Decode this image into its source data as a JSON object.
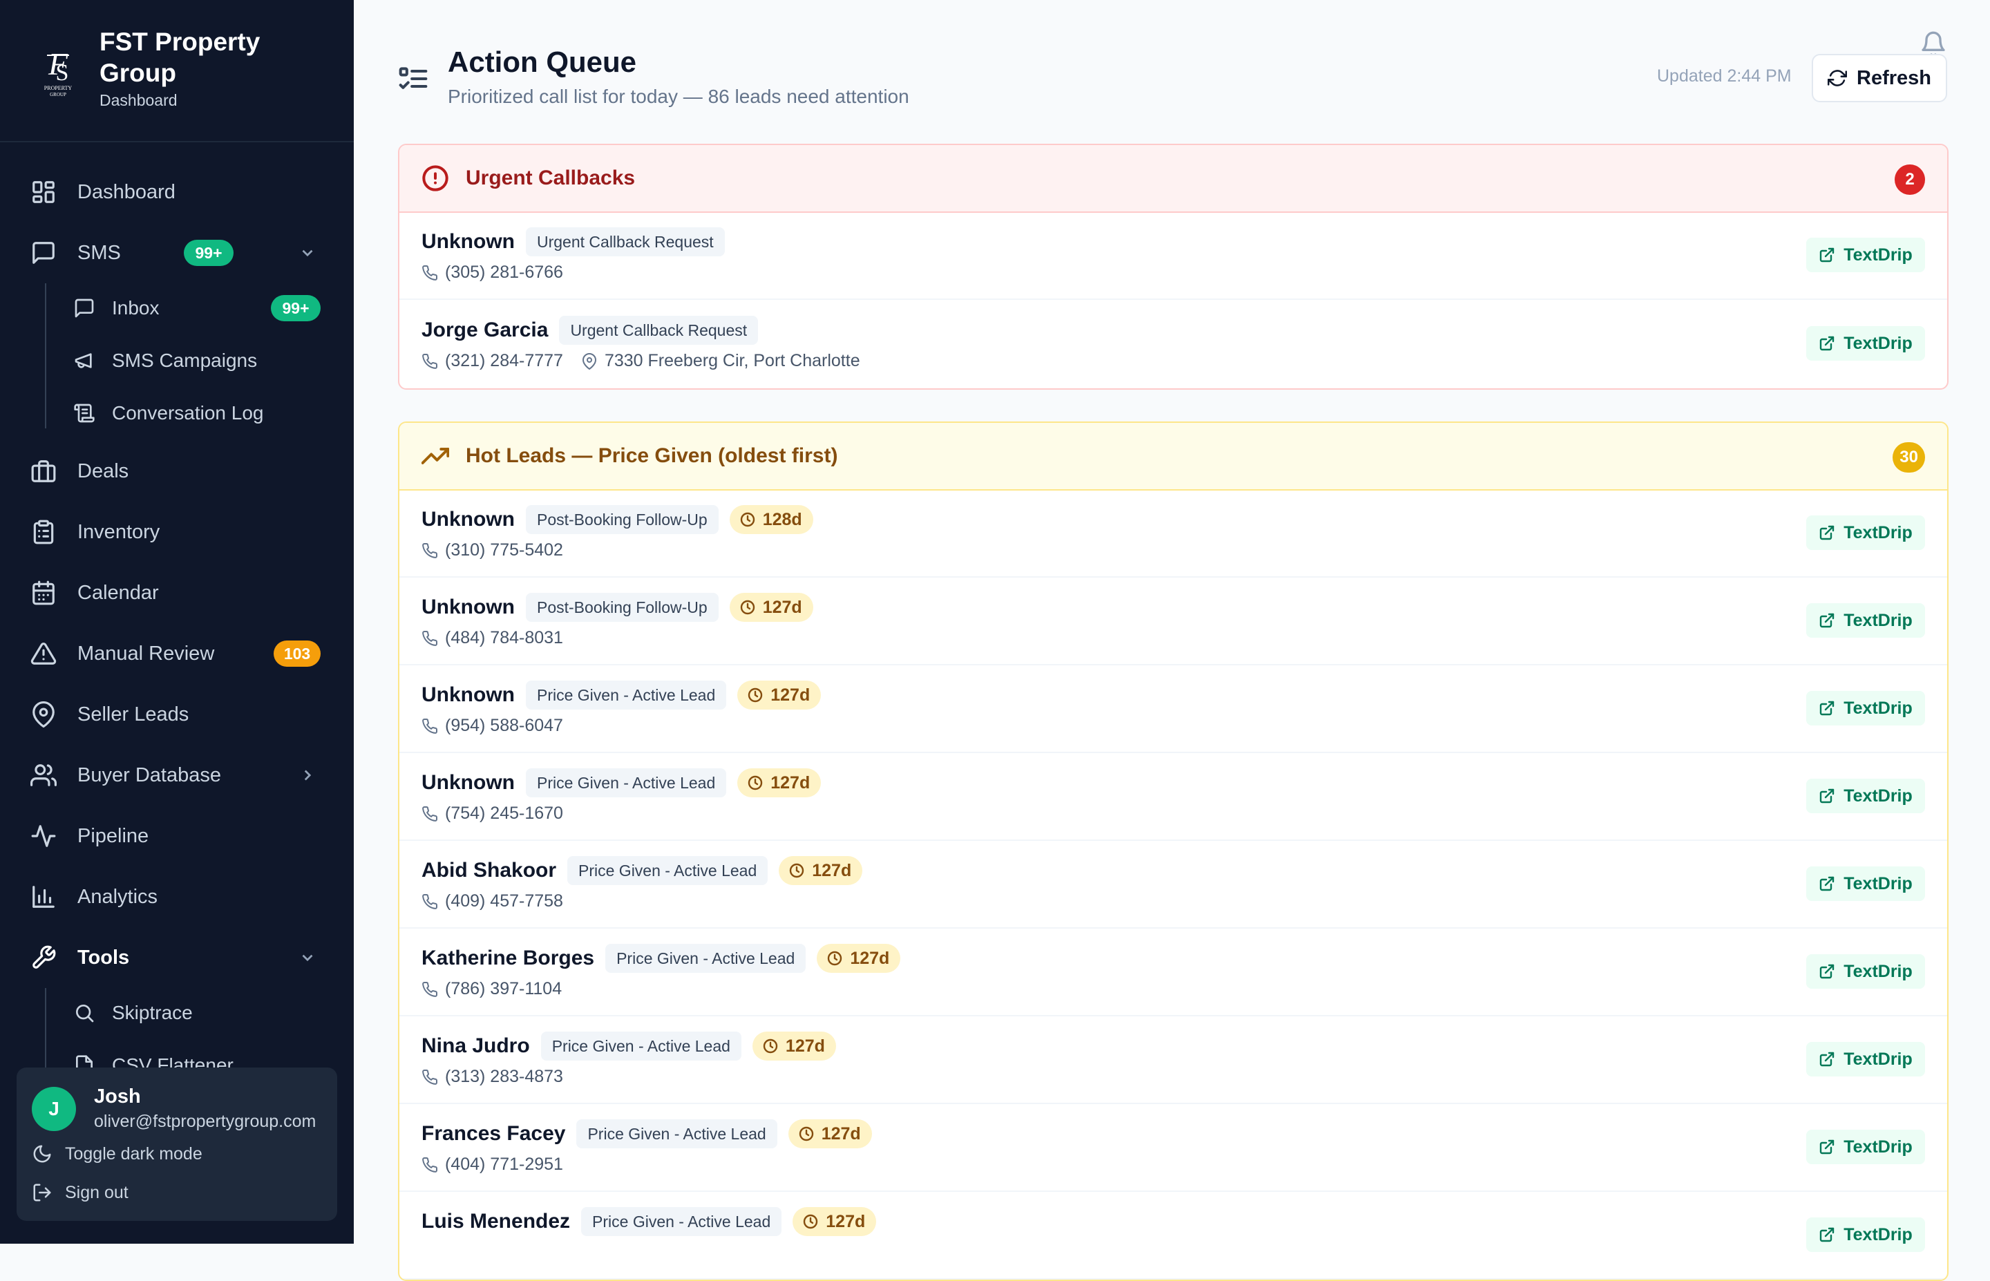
{
  "brand": {
    "name": "FST Property Group",
    "sub": "Dashboard",
    "logo_text": "FST PROPERTY GROUP"
  },
  "nav": {
    "dashboard": "Dashboard",
    "sms": "SMS",
    "sms_badge": "99+",
    "inbox": "Inbox",
    "inbox_badge": "99+",
    "sms_campaigns": "SMS Campaigns",
    "conversation_log": "Conversation Log",
    "deals": "Deals",
    "inventory": "Inventory",
    "calendar": "Calendar",
    "manual_review": "Manual Review",
    "manual_review_badge": "103",
    "seller_leads": "Seller Leads",
    "buyer_database": "Buyer Database",
    "pipeline": "Pipeline",
    "analytics": "Analytics",
    "tools": "Tools",
    "skiptrace": "Skiptrace",
    "csv_flattener": "CSV Flattener"
  },
  "user": {
    "initial": "J",
    "name": "Josh",
    "email": "oliver@fstpropertygroup.com",
    "toggle_dark": "Toggle dark mode",
    "sign_out": "Sign out"
  },
  "header": {
    "title": "Action Queue",
    "subtitle": "Prioritized call list for today — 86 leads need attention",
    "updated": "Updated 2:44 PM",
    "refresh": "Refresh"
  },
  "urgent": {
    "title": "Urgent Callbacks",
    "count": "2",
    "rows": [
      {
        "name": "Unknown",
        "tag": "Urgent Callback Request",
        "phone": "(305) 281-6766",
        "action": "TextDrip"
      },
      {
        "name": "Jorge Garcia",
        "tag": "Urgent Callback Request",
        "phone": "(321) 284-7777",
        "address": "7330 Freeberg Cir, Port Charlotte",
        "action": "TextDrip"
      }
    ]
  },
  "hot": {
    "title": "Hot Leads — Price Given (oldest first)",
    "count": "30",
    "rows": [
      {
        "name": "Unknown",
        "tag": "Post-Booking Follow-Up",
        "age": "128d",
        "phone": "(310) 775-5402",
        "action": "TextDrip"
      },
      {
        "name": "Unknown",
        "tag": "Post-Booking Follow-Up",
        "age": "127d",
        "phone": "(484) 784-8031",
        "action": "TextDrip"
      },
      {
        "name": "Unknown",
        "tag": "Price Given - Active Lead",
        "age": "127d",
        "phone": "(954) 588-6047",
        "action": "TextDrip"
      },
      {
        "name": "Unknown",
        "tag": "Price Given - Active Lead",
        "age": "127d",
        "phone": "(754) 245-1670",
        "action": "TextDrip"
      },
      {
        "name": "Abid Shakoor",
        "tag": "Price Given - Active Lead",
        "age": "127d",
        "phone": "(409) 457-7758",
        "action": "TextDrip"
      },
      {
        "name": "Katherine Borges",
        "tag": "Price Given - Active Lead",
        "age": "127d",
        "phone": "(786) 397-1104",
        "action": "TextDrip"
      },
      {
        "name": "Nina Judro",
        "tag": "Price Given - Active Lead",
        "age": "127d",
        "phone": "(313) 283-4873",
        "action": "TextDrip"
      },
      {
        "name": "Frances Facey",
        "tag": "Price Given - Active Lead",
        "age": "127d",
        "phone": "(404) 771-2951",
        "action": "TextDrip"
      },
      {
        "name": "Luis Menendez",
        "tag": "Price Given - Active Lead",
        "age": "127d",
        "phone": "",
        "action": "TextDrip"
      }
    ]
  },
  "colors": {
    "sidebar_bg": "#0f172a",
    "accent_green": "#10b981",
    "urgent_red": "#dc2626",
    "hot_yellow": "#eab308"
  }
}
